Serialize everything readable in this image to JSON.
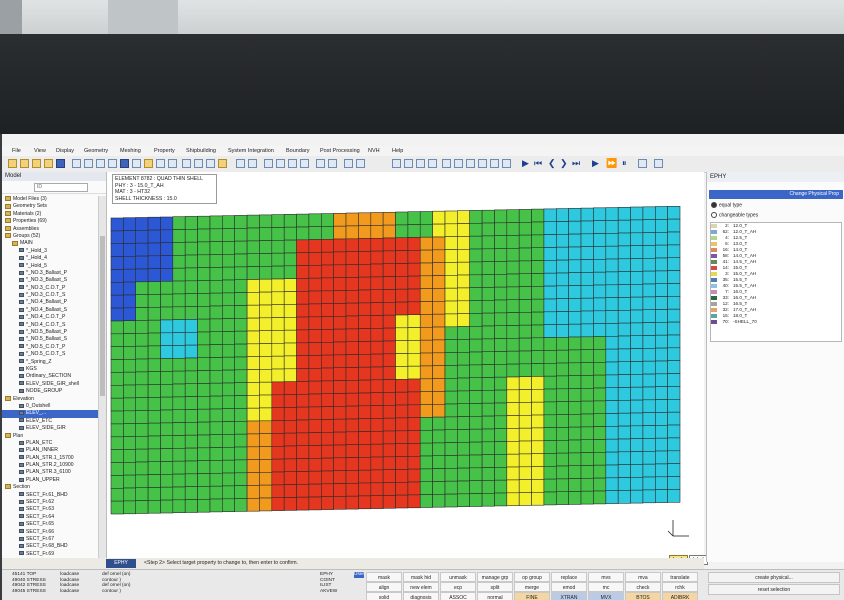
{
  "menu": [
    "File",
    "View",
    "Display",
    "Geometry",
    "Meshing",
    "Property",
    "Shipbuilding",
    "System Integration",
    "Boundary",
    "Post Processing",
    "NVH",
    "Help"
  ],
  "left_panel": {
    "title": "Model",
    "search_placeholder": "ID",
    "tree": [
      {
        "label": "Model Files (3)",
        "lvl": 0,
        "g": 1
      },
      {
        "label": "Geometry Sets",
        "lvl": 0,
        "g": 1
      },
      {
        "label": "Materials (2)",
        "lvl": 0,
        "g": 1
      },
      {
        "label": "Properties (69)",
        "lvl": 0,
        "g": 1
      },
      {
        "label": "Assemblies",
        "lvl": 0,
        "g": 1
      },
      {
        "label": "Groups (52)",
        "lvl": 0,
        "g": 1
      },
      {
        "label": "MAIN",
        "lvl": 1,
        "g": 1
      },
      {
        "label": "*_Hold_3",
        "lvl": 2
      },
      {
        "label": "*_Hold_4",
        "lvl": 2
      },
      {
        "label": "*_Hold_5",
        "lvl": 2
      },
      {
        "label": "*_NO.3_Ballast_P",
        "lvl": 2
      },
      {
        "label": "*_NO.3_Ballast_S",
        "lvl": 2
      },
      {
        "label": "*_NO.3_C.O.T_P",
        "lvl": 2
      },
      {
        "label": "*_NO.3_C.O.T_S",
        "lvl": 2
      },
      {
        "label": "*_NO.4_Ballast_P",
        "lvl": 2
      },
      {
        "label": "*_NO.4_Ballast_S",
        "lvl": 2
      },
      {
        "label": "*_NO.4_C.O.T_P",
        "lvl": 2
      },
      {
        "label": "*_NO.4_C.O.T_S",
        "lvl": 2
      },
      {
        "label": "*_NO.5_Ballast_P",
        "lvl": 2
      },
      {
        "label": "*_NO.5_Ballast_S",
        "lvl": 2
      },
      {
        "label": "*_NO.5_C.O.T_P",
        "lvl": 2
      },
      {
        "label": "*_NO.5_C.O.T_S",
        "lvl": 2
      },
      {
        "label": "*_Spring_Z",
        "lvl": 2
      },
      {
        "label": "KGS",
        "lvl": 2
      },
      {
        "label": "Ordinary_SECTION",
        "lvl": 2
      },
      {
        "label": "ELEV_SIDE_GIR_shell",
        "lvl": 2
      },
      {
        "label": "NODE_GROUP",
        "lvl": 2
      },
      {
        "label": "Elevation",
        "lvl": 0,
        "g": 1
      },
      {
        "label": "0_Outshell",
        "lvl": 2
      },
      {
        "label": "ELEV_...",
        "lvl": 2,
        "sel": 1
      },
      {
        "label": "ELEV_ETC",
        "lvl": 2
      },
      {
        "label": "ELEV_SIDE_GIR",
        "lvl": 2
      },
      {
        "label": "Plan",
        "lvl": 0,
        "g": 1
      },
      {
        "label": "PLAN_ETC",
        "lvl": 2
      },
      {
        "label": "PLAN_INNER",
        "lvl": 2
      },
      {
        "label": "PLAN_STR.1_15700",
        "lvl": 2
      },
      {
        "label": "PLAN_STR.2_10900",
        "lvl": 2
      },
      {
        "label": "PLAN_STR.3_6100",
        "lvl": 2
      },
      {
        "label": "PLAN_UPPER",
        "lvl": 2
      },
      {
        "label": "Section",
        "lvl": 0,
        "g": 1
      },
      {
        "label": "SECT_Fr.61_BHD",
        "lvl": 2
      },
      {
        "label": "SECT_Fr.62",
        "lvl": 2
      },
      {
        "label": "SECT_Fr.63",
        "lvl": 2
      },
      {
        "label": "SECT_Fr.64",
        "lvl": 2
      },
      {
        "label": "SECT_Fr.65",
        "lvl": 2
      },
      {
        "label": "SECT_Fr.66",
        "lvl": 2
      },
      {
        "label": "SECT_Fr.67",
        "lvl": 2
      },
      {
        "label": "SECT_Fr.68_BHD",
        "lvl": 2
      },
      {
        "label": "SECT_Fr.69",
        "lvl": 2
      },
      {
        "label": "SECT_Fr.70",
        "lvl": 2
      }
    ]
  },
  "element_info": {
    "line1": "ELEMENT 8782 : QUAD THIN SHELL",
    "line2": "PHY : 3 - 15.0_T_AH",
    "line3": "MAT : 3 - HT32",
    "line4": "SHELL THICKNESS : 15.0"
  },
  "viewport": {
    "colors": {
      "red": "#e5361f",
      "orange": "#f19a1e",
      "yellow": "#f4ef2b",
      "green": "#45c247",
      "cyan": "#2ec8df",
      "blue": "#2c58d6"
    },
    "chips": {
      "back": "back",
      "label": "label"
    }
  },
  "right_panel": {
    "title": "EPHY",
    "header": "Change Physical Prop",
    "radio_equal": "equal type",
    "radio_changeable": "changeable types",
    "props": [
      {
        "n": "2:",
        "v": "12.0_T",
        "c": "#d9d6b0"
      },
      {
        "n": "62:",
        "v": "12.0_T_AH",
        "c": "#7fa7d8"
      },
      {
        "n": "4:",
        "v": "12.5_T",
        "c": "#b0d88d"
      },
      {
        "n": "6:",
        "v": "13.0_T",
        "c": "#e9c26b"
      },
      {
        "n": "16:",
        "v": "14.0_T",
        "c": "#e08a5b"
      },
      {
        "n": "58:",
        "v": "14.0_T_AH",
        "c": "#7b59a8"
      },
      {
        "n": "41:",
        "v": "14.5_T_AH",
        "c": "#5e8e53"
      },
      {
        "n": "14:",
        "v": "15.0_T",
        "c": "#d44a4a"
      },
      {
        "n": "3:",
        "v": "15.0_T_AH",
        "c": "#e6d84f"
      },
      {
        "n": "35:",
        "v": "15.5_T",
        "c": "#4f7fb0"
      },
      {
        "n": "40:",
        "v": "15.5_T_AH",
        "c": "#90c2e0"
      },
      {
        "n": "7:",
        "v": "16.0_T",
        "c": "#c98bb9"
      },
      {
        "n": "33:",
        "v": "16.0_T_AH",
        "c": "#2f6b3a"
      },
      {
        "n": "12:",
        "v": "16.5_T",
        "c": "#a3a3a3"
      },
      {
        "n": "32:",
        "v": "17.0_T_AH",
        "c": "#e2a36d"
      },
      {
        "n": "15:",
        "v": "18.0_T",
        "c": "#5aa6a0"
      },
      {
        "n": "70:",
        "v": "-SHELL_70",
        "c": "#6d4f8f"
      }
    ]
  },
  "status": {
    "tag": "EPHY",
    "message": "<Step 2> Select target property to change to, then enter to confirm."
  },
  "console": {
    "left": "45141 TOP\n49040 STRESS\n49042 STRESS\n49045 STRESS",
    "mid": "loadcase\nloadcase\nloadcase\nloadcase",
    "cmds": "def ornel (on)\ncontour )\ndef ornel (on)\ncontour )",
    "tab": "User",
    "list": "EPHY\nCOINT\nILIST\nAKVEW"
  },
  "cmd_buttons": [
    [
      "mask",
      "mask hid",
      "unmask",
      "manage grp",
      "op group",
      "replace",
      "mvs",
      "mva",
      "translate"
    ],
    [
      "align",
      "new elem",
      "ecp",
      "split",
      "merge",
      "emod",
      "mc",
      "check",
      "rchk"
    ],
    [
      "solid",
      "diagnosis",
      "ASSOC",
      "normal",
      "FINE",
      "XTRAN",
      "MVX",
      "BTOS",
      "ADIBRK"
    ]
  ],
  "right_buttons": [
    "create physical...",
    "reset selection",
    ""
  ]
}
